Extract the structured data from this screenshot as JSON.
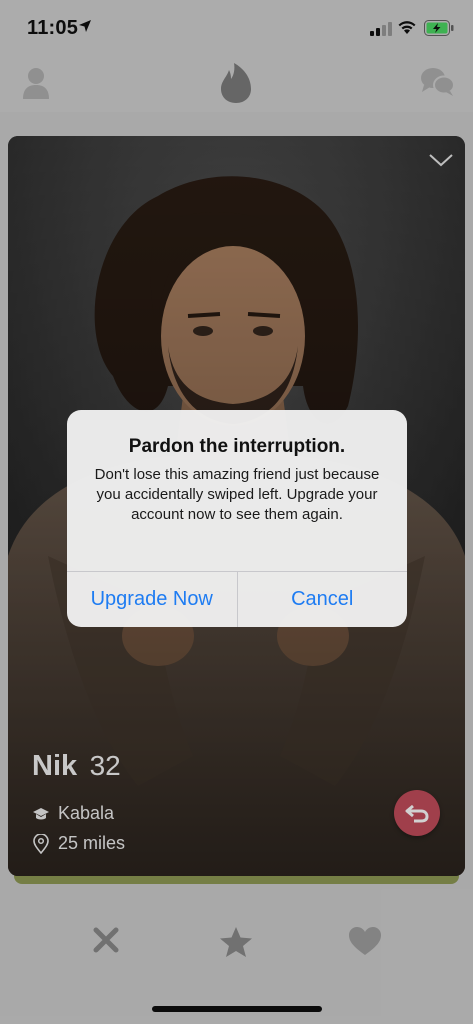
{
  "status_bar": {
    "time": "11:05",
    "battery_charging": true
  },
  "top_nav": {
    "icons": [
      "profile-icon",
      "flame-icon",
      "chat-icon"
    ]
  },
  "card": {
    "name": "Nik",
    "age": "32",
    "school": "Kabala",
    "distance": "25 miles"
  },
  "alert": {
    "title": "Pardon the interruption.",
    "message": "Don't lose this amazing friend just because you accidentally swiped left. Upgrade your account now to see them again.",
    "primary_button": "Upgrade Now",
    "secondary_button": "Cancel"
  },
  "bottom_actions": [
    "nope-icon",
    "super-like-icon",
    "like-icon"
  ],
  "colors": {
    "accent": "#1e7cf2",
    "rewind": "#c44d5c",
    "background": "#d2d2d2"
  }
}
